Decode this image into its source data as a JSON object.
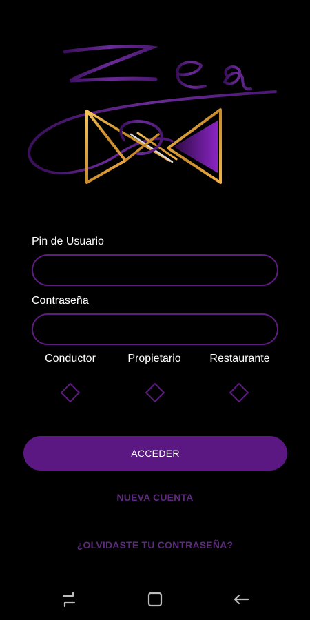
{
  "login": {
    "pin_label": "Pin de Usuario",
    "pin_value": "",
    "password_label": "Contraseña",
    "password_value": ""
  },
  "roles": [
    {
      "label": "Conductor",
      "checked": false
    },
    {
      "label": "Propietario",
      "checked": false
    },
    {
      "label": "Restaurante",
      "checked": false
    }
  ],
  "actions": {
    "submit_label": "ACCEDER",
    "new_account_label": "NUEVA CUENTA",
    "forgot_password_label": "¿OLVIDASTE TU CONTRASEÑA?"
  },
  "navbar": {
    "items": [
      "recents-icon",
      "home-icon",
      "back-icon"
    ]
  },
  "colors": {
    "background": "#000000",
    "accent_purple": "#5b1882",
    "input_border": "#5e1b82",
    "link_purple": "#5d2a7d",
    "logo_gold": "#e3a13a"
  }
}
